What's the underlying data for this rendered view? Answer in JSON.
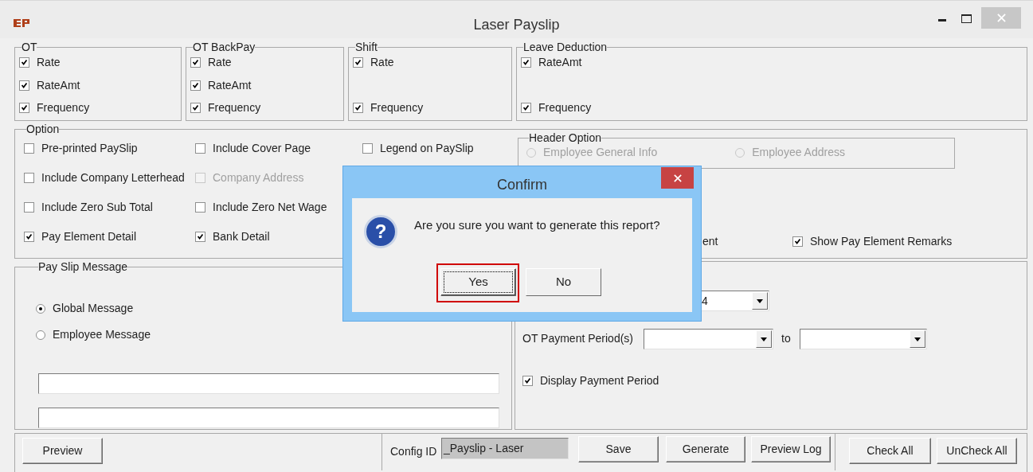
{
  "window": {
    "title": "Laser Payslip"
  },
  "groups": [
    {
      "title": "OT",
      "items": [
        {
          "label": "Rate",
          "checked": true
        },
        {
          "label": "RateAmt",
          "checked": true
        },
        {
          "label": "Frequency",
          "checked": true
        }
      ]
    },
    {
      "title": "OT BackPay",
      "items": [
        {
          "label": "Rate",
          "checked": true
        },
        {
          "label": "RateAmt",
          "checked": true
        },
        {
          "label": "Frequency",
          "checked": true
        }
      ]
    },
    {
      "title": "Shift",
      "items": [
        {
          "label": "Rate",
          "checked": true
        },
        {
          "label": "Frequency",
          "checked": true
        }
      ]
    },
    {
      "title": "Leave Deduction",
      "items": [
        {
          "label": "RateAmt",
          "checked": true
        },
        {
          "label": "Frequency",
          "checked": true
        }
      ]
    }
  ],
  "option": {
    "title": "Option",
    "rows": [
      [
        {
          "label": "Pre-printed PaySlip",
          "checked": false,
          "disabled": false
        },
        {
          "label": "Include Cover Page",
          "checked": false,
          "disabled": false
        },
        {
          "label": "Legend on PaySlip",
          "checked": false,
          "disabled": false
        }
      ],
      [
        {
          "label": "Include Company Letterhead",
          "checked": false,
          "disabled": false
        },
        {
          "label": "Company Address",
          "checked": false,
          "disabled": true
        }
      ],
      [
        {
          "label": "Include Zero Sub Total",
          "checked": false,
          "disabled": false
        },
        {
          "label": "Include Zero Net Wage",
          "checked": false,
          "disabled": false
        }
      ],
      [
        {
          "label": "Pay Element Detail",
          "checked": true,
          "disabled": false
        },
        {
          "label": "Bank Detail",
          "checked": true,
          "disabled": false
        }
      ]
    ],
    "header_option": {
      "title": "Header Option",
      "radios": [
        {
          "label": "Employee General Info",
          "selected": false,
          "disabled": true
        },
        {
          "label": "Employee Address",
          "selected": false,
          "disabled": true
        }
      ]
    },
    "covered_label_tail": "ent",
    "show_remarks": {
      "label": "Show Pay Element Remarks",
      "checked": true
    }
  },
  "pay_slip_message": {
    "title": "Pay Slip Message",
    "radios": [
      {
        "label": "Global Message",
        "selected": true
      },
      {
        "label": "Employee Message",
        "selected": false
      }
    ]
  },
  "period": {
    "covered_dropdown_value": "4",
    "ot_label": "OT Payment Period(s)",
    "to_label": "to",
    "display_payment_period": {
      "label": "Display Payment Period",
      "checked": true
    }
  },
  "bottom": {
    "preview": "Preview",
    "config_label": "Config ID",
    "config_value": "_Payslip - Laser",
    "buttons": [
      "Save",
      "Generate",
      "Preview Log"
    ],
    "check_buttons": [
      "Check All",
      "UnCheck All"
    ]
  },
  "dialog": {
    "title": "Confirm",
    "icon_glyph": "?",
    "message": "Are you sure you want to generate this report?",
    "buttons": [
      {
        "label": "Yes",
        "focused": true,
        "highlighted": true
      },
      {
        "label": "No",
        "focused": false,
        "highlighted": false
      }
    ]
  }
}
